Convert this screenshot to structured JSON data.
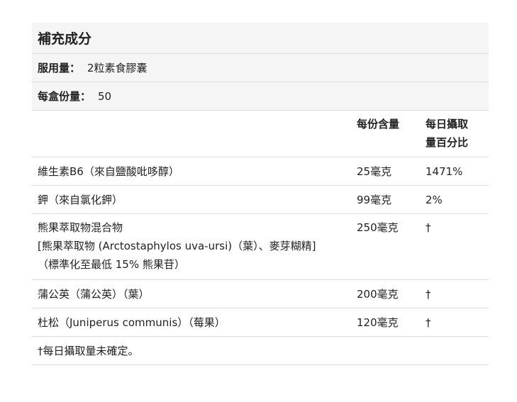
{
  "title": "補充成分",
  "serving_size": {
    "label": "服用量：",
    "value": "2粒素食膠囊"
  },
  "servings_per_container": {
    "label": "每盒份量：",
    "value": "50"
  },
  "columns": {
    "amount": "每份含量",
    "daily_value_line1": "每日攝取",
    "daily_value_line2": "量百分比"
  },
  "rows": [
    {
      "name": "維生素B6（來自鹽酸吡哆醇）",
      "amount": "25毫克",
      "dv": "1471%"
    },
    {
      "name": "鉀（來自氯化鉀）",
      "amount": "99毫克",
      "dv": "2%"
    },
    {
      "name_lines": [
        "熊果萃取物混合物",
        "[熊果萃取物 (Arctostaphylos uva-ursi)（葉）、麥芽糊精]",
        "（標準化至最低 15% 熊果苷）"
      ],
      "amount": "250毫克",
      "dv": "†"
    },
    {
      "name": "蒲公英（蒲公英）（葉）",
      "amount": "200毫克",
      "dv": "†"
    },
    {
      "name": "杜松（Juniperus communis）（莓果）",
      "amount": "120毫克",
      "dv": "†"
    }
  ],
  "footnote": "†每日攝取量未確定。"
}
